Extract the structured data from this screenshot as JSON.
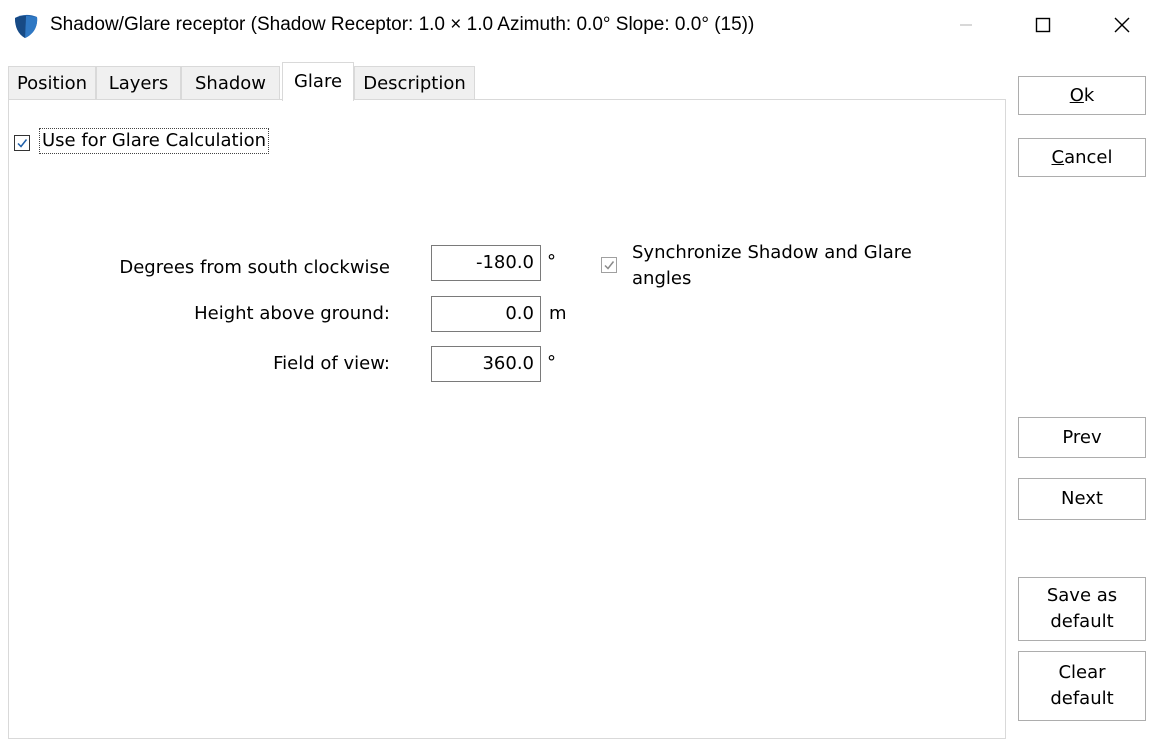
{
  "window": {
    "title": "Shadow/Glare receptor   (Shadow Receptor: 1.0 × 1.0  Azimuth: 0.0°  Slope: 0.0° (15))"
  },
  "tabs": [
    {
      "label": "Position"
    },
    {
      "label": "Layers"
    },
    {
      "label": "Shadow"
    },
    {
      "label": "Glare"
    },
    {
      "label": "Description"
    }
  ],
  "glare": {
    "use_checkbox_label": "Use for Glare Calculation",
    "use_checked": true,
    "degrees_label": "Degrees from south clockwise",
    "degrees_value": "-180.0",
    "degrees_unit": "°",
    "height_label": "Height above ground:",
    "height_value": "0.0",
    "height_unit": "m",
    "fov_label": "Field of view:",
    "fov_value": "360.0",
    "fov_unit": "°",
    "sync_label_line1": "Synchronize Shadow and Glare",
    "sync_label_line2": "angles",
    "sync_checked": true
  },
  "buttons": {
    "ok_first": "O",
    "ok_rest": "k",
    "cancel_first": "C",
    "cancel_rest": "ancel",
    "prev": "Prev",
    "next": "Next",
    "save_default_line1": "Save as",
    "save_default_line2": "default",
    "clear_default_line1": "Clear",
    "clear_default_line2": "default"
  },
  "icons": [
    "app-shield-icon",
    "minimize-icon",
    "maximize-icon",
    "close-icon",
    "checkmark-icon"
  ],
  "colors": {
    "icon_blue": "#1f5fa8",
    "border": "#d9d9d9",
    "disabled": "#8a8a8a"
  }
}
